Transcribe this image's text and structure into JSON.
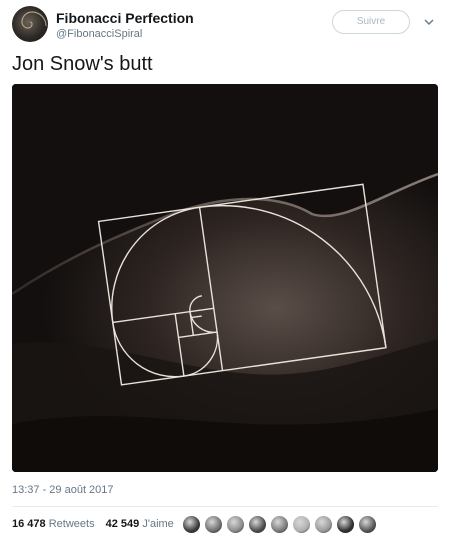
{
  "author": {
    "display_name": "Fibonacci Perfection",
    "handle": "@FibonacciSpiral"
  },
  "follow_button": {
    "label": "Suivre"
  },
  "tweet": {
    "text": "Jon Snow's butt",
    "timestamp": "13:37 - 29 août 2017"
  },
  "stats": {
    "retweets_count": "16 478",
    "retweets_label": "Retweets",
    "likes_count": "42 549",
    "likes_label": "J'aime"
  },
  "liker_avatars": [
    {
      "name": "liker-avatar-1",
      "color": "#3a3a3a"
    },
    {
      "name": "liker-avatar-2",
      "color": "#6e6e6e"
    },
    {
      "name": "liker-avatar-3",
      "color": "#8a8a8a"
    },
    {
      "name": "liker-avatar-4",
      "color": "#4b4b4b"
    },
    {
      "name": "liker-avatar-5",
      "color": "#7a7a7a"
    },
    {
      "name": "liker-avatar-6",
      "color": "#b0b0b0"
    },
    {
      "name": "liker-avatar-7",
      "color": "#9a9a9a"
    },
    {
      "name": "liker-avatar-8",
      "color": "#2f2f2f"
    },
    {
      "name": "liker-avatar-9",
      "color": "#555555"
    }
  ],
  "colors": {
    "text_primary": "#14171a",
    "text_secondary": "#657786",
    "button_border": "#ccd6dd",
    "media_background": "#120f0e"
  }
}
